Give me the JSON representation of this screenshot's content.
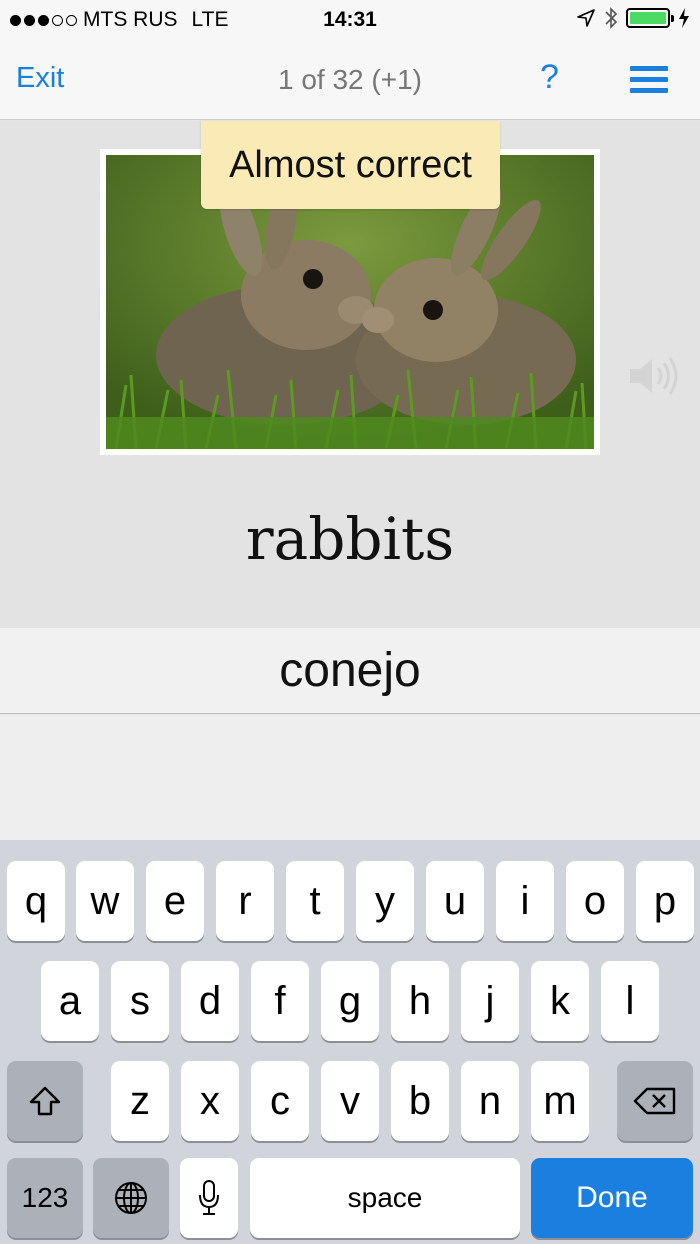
{
  "status_bar": {
    "carrier": "MTS RUS",
    "network": "LTE",
    "time": "14:31"
  },
  "nav": {
    "exit_label": "Exit",
    "title": "1 of 32 (+1)",
    "help_label": "?",
    "menu_icon": "hamburger-menu-icon"
  },
  "card": {
    "feedback": "Almost correct",
    "term": "rabbits",
    "image_icon": "rabbits-photo",
    "speaker_icon": "speaker-icon"
  },
  "answer": {
    "value": "conejo"
  },
  "keyboard": {
    "row1": [
      "q",
      "w",
      "e",
      "r",
      "t",
      "y",
      "u",
      "i",
      "o",
      "p"
    ],
    "row2": [
      "a",
      "s",
      "d",
      "f",
      "g",
      "h",
      "j",
      "k",
      "l"
    ],
    "row3": [
      "z",
      "x",
      "c",
      "v",
      "b",
      "n",
      "m"
    ],
    "numbers_label": "123",
    "space_label": "space",
    "done_label": "Done"
  },
  "colors": {
    "accent": "#1b7fe0",
    "feedback_bg": "#faeab6",
    "battery": "#4cd964"
  }
}
